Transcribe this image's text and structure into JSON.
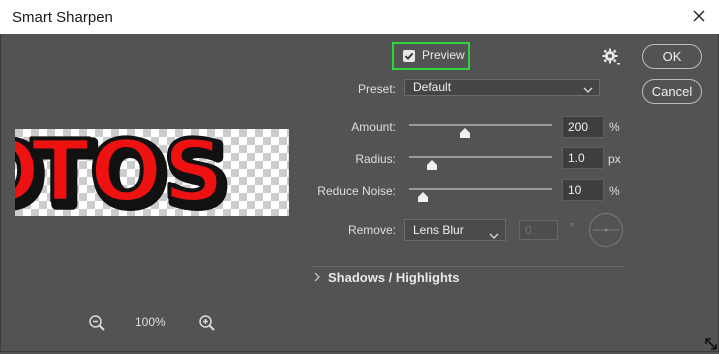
{
  "window": {
    "title": "Smart Sharpen"
  },
  "preview": {
    "label": "Preview",
    "checked": true
  },
  "buttons": {
    "ok": "OK",
    "cancel": "Cancel"
  },
  "preset": {
    "label": "Preset:",
    "value": "Default"
  },
  "amount": {
    "label": "Amount:",
    "value": "200",
    "unit": "%",
    "slider_fraction": 0.39
  },
  "radius": {
    "label": "Radius:",
    "value": "1.0",
    "unit": "px",
    "slider_fraction": 0.16
  },
  "reduce_noise": {
    "label": "Reduce Noise:",
    "value": "10",
    "unit": "%",
    "slider_fraction": 0.1
  },
  "remove": {
    "label": "Remove:",
    "value": "Lens Blur",
    "angle": "0",
    "angle_unit": "°"
  },
  "section": {
    "label": "Shadows / Highlights"
  },
  "preview_image": {
    "text": "TOS"
  },
  "zoom": {
    "value": "100%"
  },
  "colors": {
    "highlight": "#31d13b",
    "bg": "#535353",
    "text_red": "#ee1111"
  }
}
